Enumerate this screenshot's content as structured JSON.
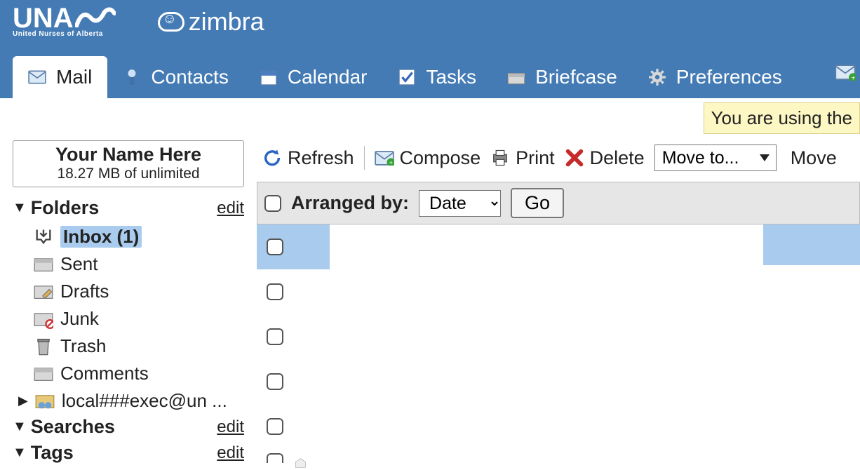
{
  "topbar": {
    "una_main": "UNA",
    "una_sub": "United Nurses of Alberta",
    "zimbra": "zimbra"
  },
  "tabs": {
    "mail": "Mail",
    "contacts": "Contacts",
    "calendar": "Calendar",
    "tasks": "Tasks",
    "briefcase": "Briefcase",
    "preferences": "Preferences"
  },
  "notice": "You are using the",
  "user": {
    "name": "Your Name Here",
    "quota": "18.27 MB of unlimited"
  },
  "sidebar": {
    "folders_label": "Folders",
    "edit": "edit",
    "items": {
      "inbox": "Inbox (1)",
      "sent": "Sent",
      "drafts": "Drafts",
      "junk": "Junk",
      "trash": "Trash",
      "comments": "Comments",
      "shared": "local###exec@un ..."
    },
    "searches_label": "Searches",
    "tags_label": "Tags"
  },
  "toolbar": {
    "refresh": "Refresh",
    "compose": "Compose",
    "print": "Print",
    "delete": "Delete",
    "moveto": "Move to...",
    "move": "Move"
  },
  "arrange": {
    "label": "Arranged by:",
    "value": "Date",
    "go": "Go"
  }
}
